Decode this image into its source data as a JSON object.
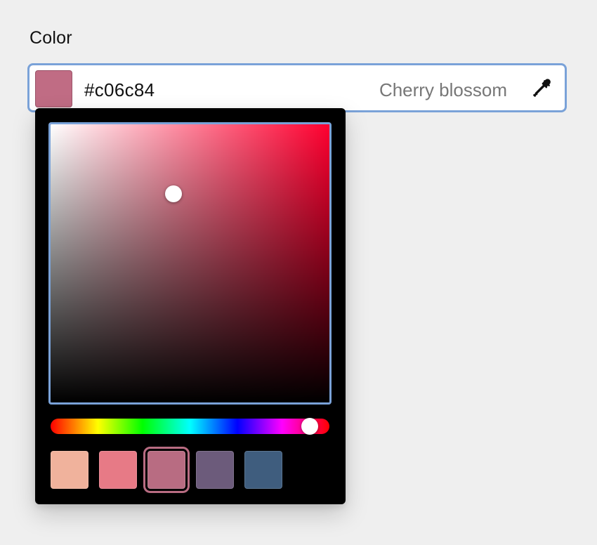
{
  "field": {
    "label": "Color",
    "hex": "#c06c84",
    "name": "Cherry blossom"
  },
  "icons": {
    "eyedropper": "eyedropper-icon"
  },
  "picker": {
    "hue_color": "#ff0030",
    "saturation": 0.44,
    "value": 0.75,
    "hue_position": 0.93
  },
  "presets": [
    {
      "color": "#f0b29c",
      "selected": false
    },
    {
      "color": "#e77a86",
      "selected": false
    },
    {
      "color": "#b86c82",
      "selected": true
    },
    {
      "color": "#6c5b7b",
      "selected": false
    },
    {
      "color": "#3f5d7e",
      "selected": false
    }
  ],
  "colors": {
    "focus_ring": "#7aa2d8",
    "background": "#efefef",
    "popover": "#000000"
  }
}
